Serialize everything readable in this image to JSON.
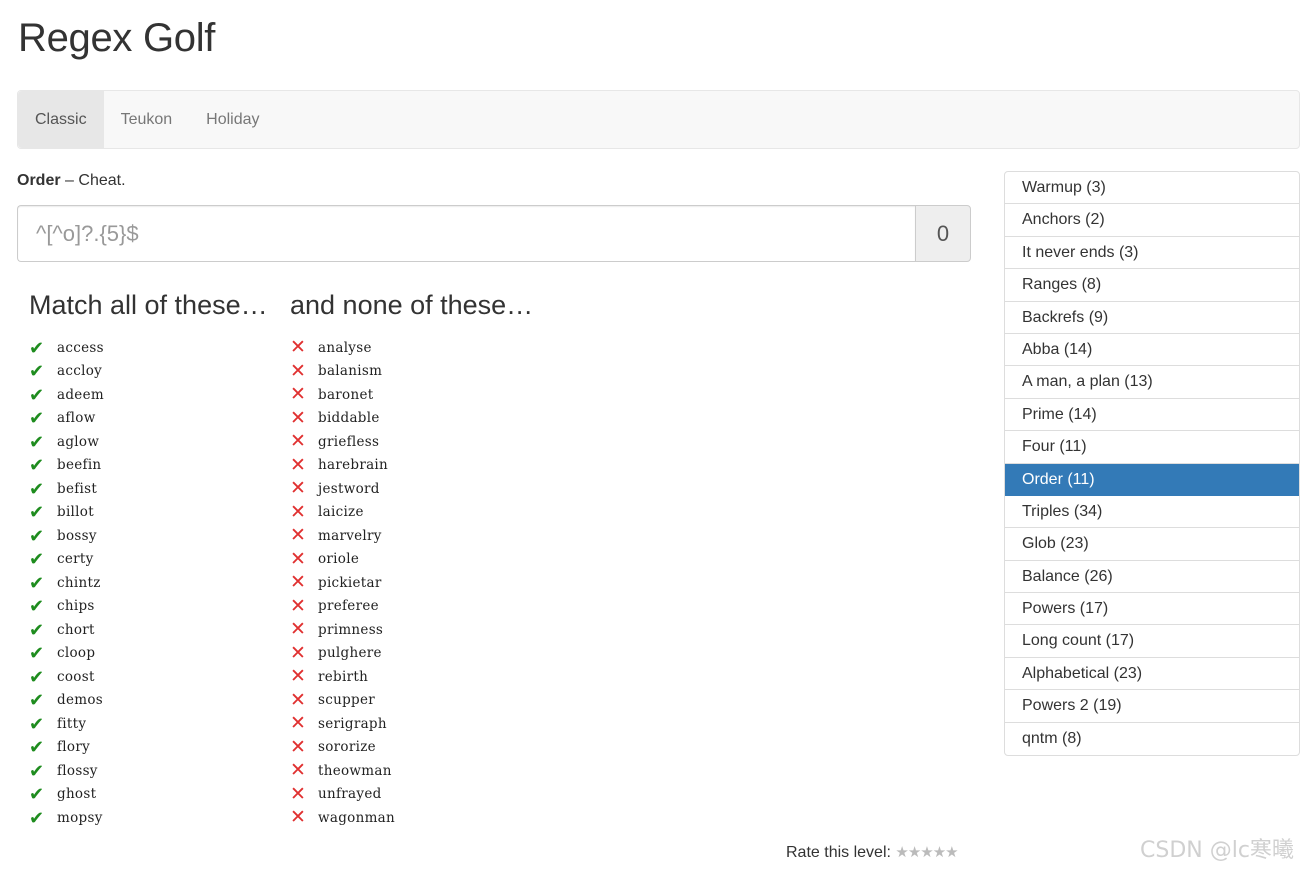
{
  "title": "Regex Golf",
  "nav": {
    "tabs": [
      {
        "label": "Classic",
        "active": true
      },
      {
        "label": "Teukon",
        "active": false
      },
      {
        "label": "Holiday",
        "active": false
      }
    ]
  },
  "level": {
    "name": "Order",
    "separator": "–",
    "description": "Cheat."
  },
  "regex": {
    "placeholder": "^[^o]?.{5}$",
    "value": "",
    "score": "0"
  },
  "match": {
    "heading": "Match all of these…",
    "icon": "check-icon",
    "color": "#1e8c1e",
    "words": [
      "access",
      "accloy",
      "adeem",
      "aflow",
      "aglow",
      "beefin",
      "befist",
      "billot",
      "bossy",
      "certy",
      "chintz",
      "chips",
      "chort",
      "cloop",
      "coost",
      "demos",
      "fitty",
      "flory",
      "flossy",
      "ghost",
      "mopsy"
    ]
  },
  "none": {
    "heading": "and none of these…",
    "icon": "cross-icon",
    "color": "#e03030",
    "words": [
      "analyse",
      "balanism",
      "baronet",
      "biddable",
      "griefless",
      "harebrain",
      "jestword",
      "laicize",
      "marvelry",
      "oriole",
      "pickietar",
      "preferee",
      "primness",
      "pulghere",
      "rebirth",
      "scupper",
      "serigraph",
      "sororize",
      "theowman",
      "unfrayed",
      "wagonman"
    ]
  },
  "levels": [
    {
      "label": "Warmup (3)"
    },
    {
      "label": "Anchors (2)"
    },
    {
      "label": "It never ends (3)"
    },
    {
      "label": "Ranges (8)"
    },
    {
      "label": "Backrefs (9)"
    },
    {
      "label": "Abba (14)"
    },
    {
      "label": "A man, a plan (13)"
    },
    {
      "label": "Prime (14)"
    },
    {
      "label": "Four (11)"
    },
    {
      "label": "Order (11)",
      "active": true
    },
    {
      "label": "Triples (34)"
    },
    {
      "label": "Glob (23)"
    },
    {
      "label": "Balance (26)"
    },
    {
      "label": "Powers (17)"
    },
    {
      "label": "Long count (17)"
    },
    {
      "label": "Alphabetical (23)"
    },
    {
      "label": "Powers 2 (19)"
    },
    {
      "label": "qntm (8)"
    }
  ],
  "rating": {
    "label": "Rate this level:",
    "stars": "★★★★★"
  },
  "watermark": "CSDN @lc寒曦"
}
